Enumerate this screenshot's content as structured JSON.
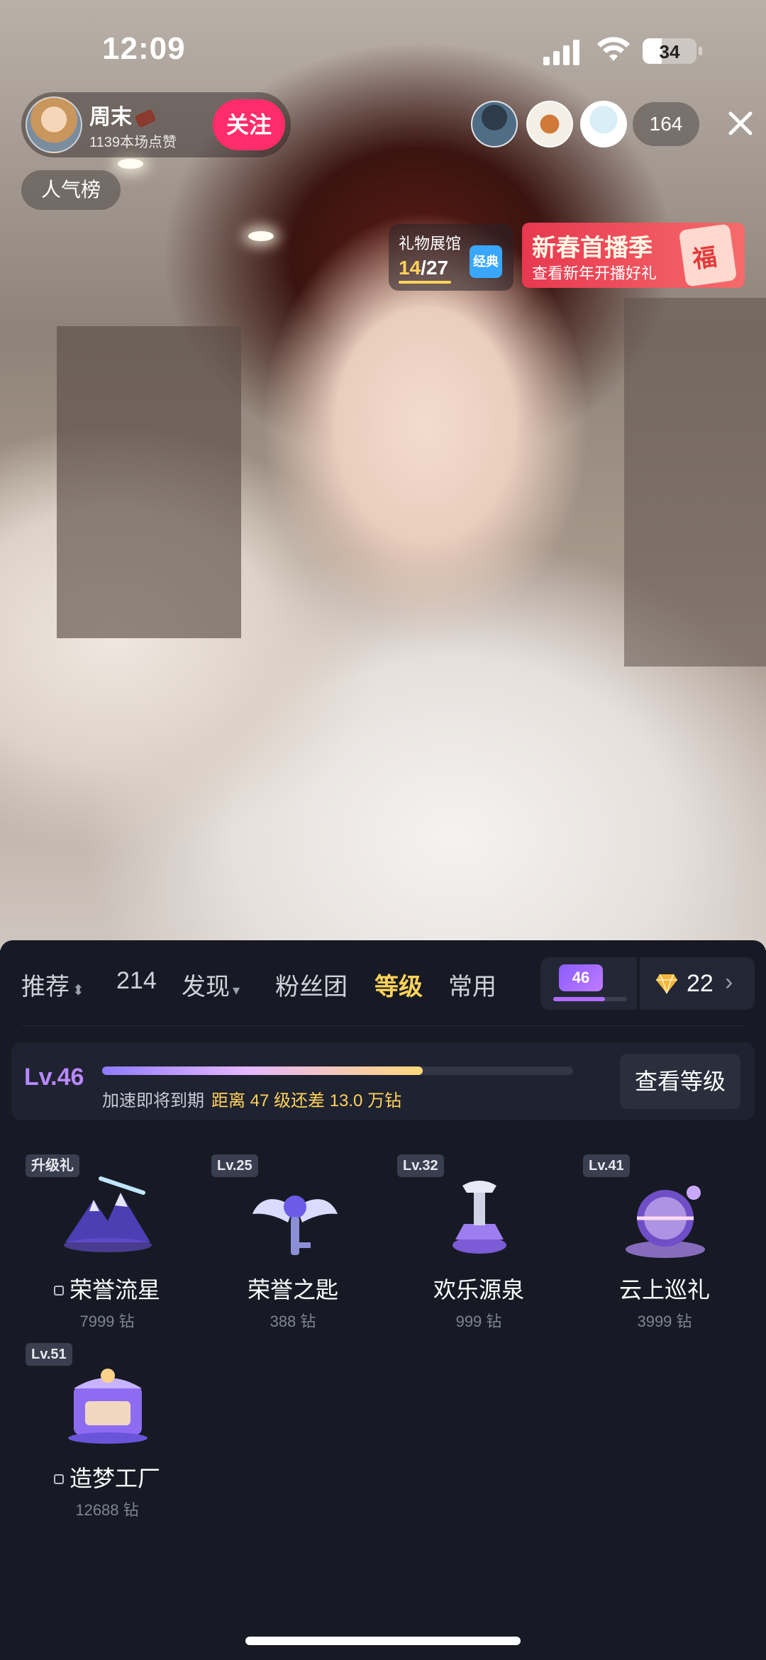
{
  "status_bar": {
    "time": "12:09",
    "battery": "34"
  },
  "host": {
    "name": "周末",
    "likes": "1139本场点赞",
    "follow_label": "关注"
  },
  "popular_label": "人气榜",
  "viewers": {
    "count": "164"
  },
  "pavilion": {
    "title": "礼物展馆",
    "progress_current": "14",
    "progress_total": "/27",
    "tag": "经典"
  },
  "promo": {
    "title": "新春首播季",
    "subtitle": "查看新年开播好礼",
    "badge": "福"
  },
  "tabs": [
    {
      "label": "推荐",
      "caret": "⬍"
    },
    {
      "label": "214"
    },
    {
      "label": "发现",
      "caret": "▾"
    },
    {
      "label": "粉丝团"
    },
    {
      "label": "等级"
    },
    {
      "label": "常用"
    }
  ],
  "level_chip": {
    "level": "46",
    "progress": 0.7
  },
  "diamonds": {
    "count": "22",
    "chevron": "›"
  },
  "level_card": {
    "level": "Lv.46",
    "progress": 0.68,
    "note": "加速即将到期",
    "detail": "距离 47 级还差 13.0 万钻",
    "button": "查看等级"
  },
  "gifts": [
    {
      "badge": "升级礼",
      "name": "荣誉流星",
      "price": "7999 钻",
      "locked": true
    },
    {
      "badge": "Lv.25",
      "name": "荣誉之匙",
      "price": "388 钻",
      "locked": false
    },
    {
      "badge": "Lv.32",
      "name": "欢乐源泉",
      "price": "999 钻",
      "locked": false
    },
    {
      "badge": "Lv.41",
      "name": "云上巡礼",
      "price": "3999 钻",
      "locked": false
    },
    {
      "badge": "Lv.51",
      "name": "造梦工厂",
      "price": "12688 钻",
      "locked": true
    }
  ],
  "colors": {
    "accent_pink": "#fe2c6a",
    "gold": "#ffd35a",
    "purple": "#b889ff",
    "panel_bg": "#171a24"
  }
}
